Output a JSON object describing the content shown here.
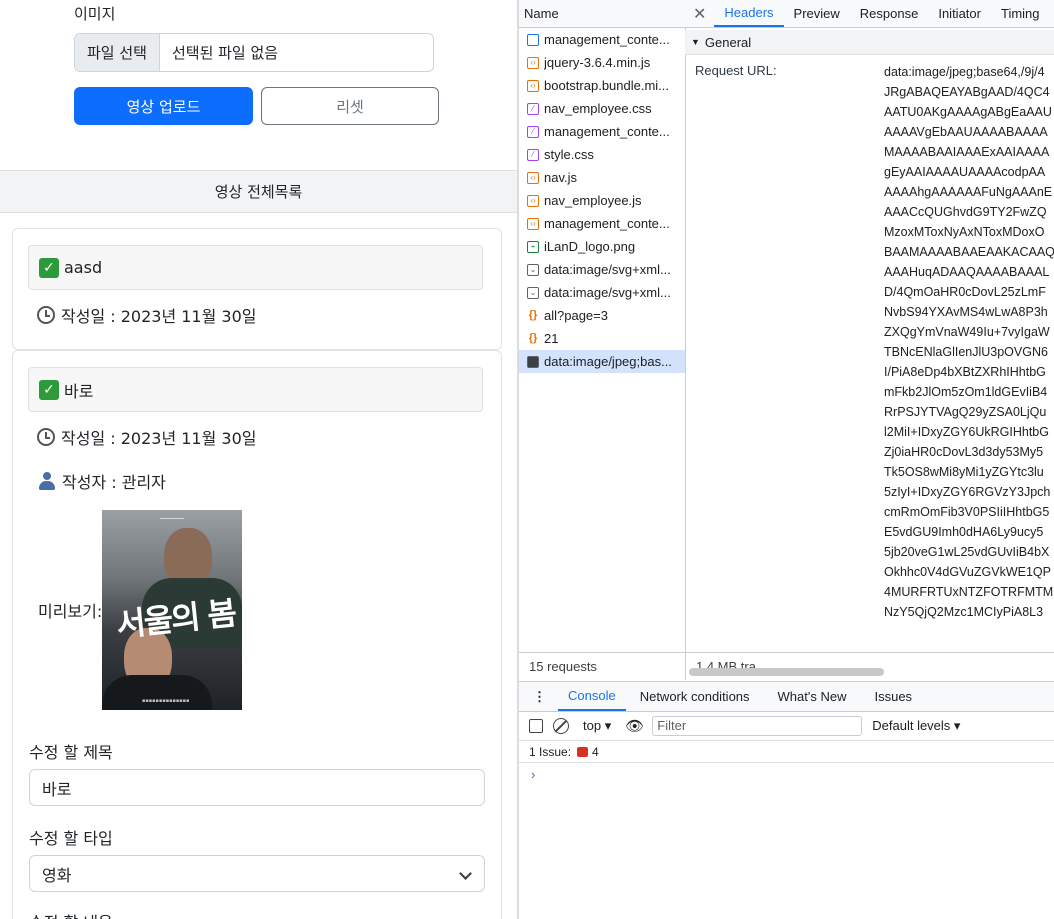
{
  "form": {
    "image_label": "이미지",
    "file_button": "파일 선택",
    "file_none": "선택된 파일 없음",
    "upload_button": "영상 업로드",
    "reset_button": "리셋"
  },
  "list": {
    "header": "영상 전체목록",
    "items": [
      {
        "title": "aasd",
        "created": "작성일 : 2023년 11월 30일"
      },
      {
        "title": "바로",
        "created": "작성일 : 2023년 11월 30일",
        "author": "작성자 : 관리자",
        "preview_label": "미리보기:",
        "poster_title": "서울의 봄",
        "edit_title_label": "수정 할 제목",
        "edit_title_value": "바로",
        "edit_type_label": "수정 할 타입",
        "edit_type_value": "영화",
        "edit_content_label": "수정 할 내용"
      }
    ]
  },
  "devtools": {
    "name_header": "Name",
    "requests": [
      {
        "name": "management_conte...",
        "icon": "doc"
      },
      {
        "name": "jquery-3.6.4.min.js",
        "icon": "js"
      },
      {
        "name": "bootstrap.bundle.mi...",
        "icon": "js"
      },
      {
        "name": "nav_employee.css",
        "icon": "css"
      },
      {
        "name": "management_conte...",
        "icon": "css"
      },
      {
        "name": "style.css",
        "icon": "css"
      },
      {
        "name": "nav.js",
        "icon": "js"
      },
      {
        "name": "nav_employee.js",
        "icon": "js"
      },
      {
        "name": "management_conte...",
        "icon": "js"
      },
      {
        "name": "iLanD_logo.png",
        "icon": "img"
      },
      {
        "name": "data:image/svg+xml...",
        "icon": "svg"
      },
      {
        "name": "data:image/svg+xml...",
        "icon": "svg"
      },
      {
        "name": "all?page=3",
        "icon": "fetch"
      },
      {
        "name": "21",
        "icon": "fetch"
      },
      {
        "name": "data:image/jpeg;bas...",
        "icon": "jpg",
        "selected": true
      }
    ],
    "footer_requests": "15 requests",
    "footer_size": "1.4 MB tra",
    "tabs": [
      "Headers",
      "Preview",
      "Response",
      "Initiator",
      "Timing"
    ],
    "active_tab": "Headers",
    "general_label": "General",
    "request_url_label": "Request URL:",
    "request_url_lines": [
      "data:image/jpeg;base64,/9j/4",
      "JRgABAQEAYABgAAD/4QC4",
      "AATU0AKgAAAAgABgEaAAU",
      "AAAAVgEbAAUAAAABAAAA",
      "MAAAABAAIAAAExAAIAAAA",
      "gEyAAIAAAAUAAAAcodpAA",
      "AAAAhgAAAAAAFuNgAAAnE",
      "AAACcQUGhvdG9TY2FwZQ",
      "MzoxMToxNyAxNToxMDoxO",
      "BAAMAAAABAAEAAKACAAQ",
      "AAAHuqADAAQAAAABAAAL",
      "D/4QmOaHR0cDovL25zLmF",
      "NvbS94YXAvMS4wLwA8P3h",
      "ZXQgYmVnaW49Iu+7vyIgaW",
      "TBNcENlaGlIenJlU3pOVGN6",
      "I/PiA8eDp4bXBtZXRhIHhtbG",
      "mFkb2JlOm5zOm1ldGEvIiB4",
      "RrPSJYTVAgQ29yZSA0LjQu",
      "l2MiI+IDxyZGY6UkRGIHhtbG",
      "Zj0iaHR0cDovL3d3dy53My5",
      "Tk5OS8wMi8yMi1yZGYtc3lu",
      "5zIyI+IDxyZGY6RGVzY3Jpch",
      "cmRmOmFib3V0PSIiIHhtbG5",
      "E5vdGU9Imh0dHA6Ly9ucy5",
      "5jb20veG1wL25vdGUvIiB4bX",
      "Okhhc0V4dGVuZGVkWE1QP",
      "4MURFRTUxNTZFOTRFMTM",
      "NzY5QjQ2Mzc1MCIyPiA8L3"
    ],
    "drawer_tabs": [
      "Console",
      "Network conditions",
      "What's New",
      "Issues"
    ],
    "active_drawer_tab": "Console",
    "context": "top",
    "filter_placeholder": "Filter",
    "levels": "Default levels",
    "issues_label": "1 Issue:",
    "issues_count": "4",
    "prompt": "›"
  }
}
